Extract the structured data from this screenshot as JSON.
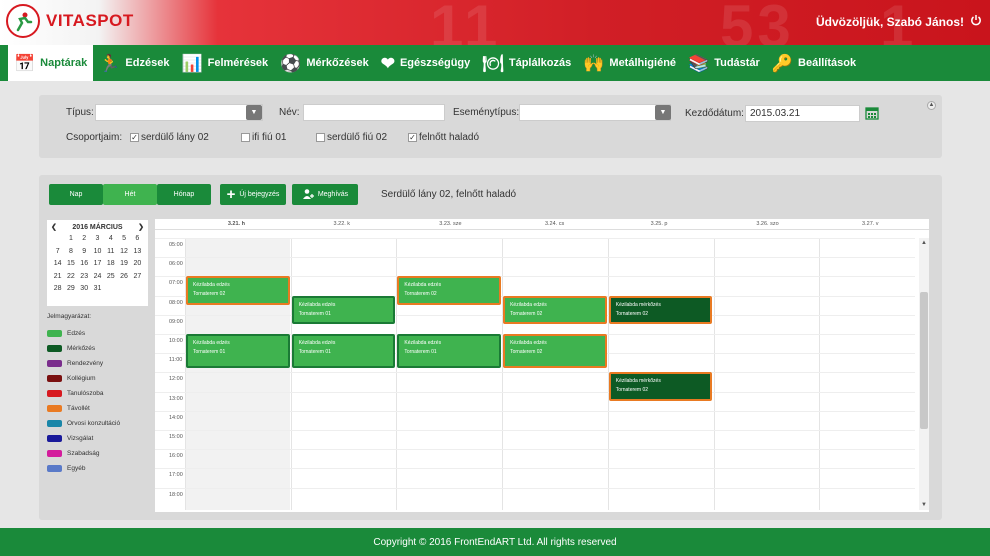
{
  "header": {
    "brand": "VITASPOT",
    "welcome": "Üdvözöljük, Szabó János!",
    "ghost_numbers": [
      "11",
      "53",
      "1"
    ]
  },
  "nav": [
    {
      "label": "Naptárak",
      "icon": "calendar-icon",
      "glyph": "📅",
      "active": true
    },
    {
      "label": "Edzések",
      "icon": "running-icon",
      "glyph": "🏃"
    },
    {
      "label": "Felmérések",
      "icon": "bar-chart-icon",
      "glyph": "📊"
    },
    {
      "label": "Mérkőzések",
      "icon": "players-icon",
      "glyph": "⚽"
    },
    {
      "label": "Egészségügy",
      "icon": "heart-icon",
      "glyph": "❤"
    },
    {
      "label": "Táplálkozás",
      "icon": "plate-icon",
      "glyph": "🍽"
    },
    {
      "label": "Metálhigiéné",
      "icon": "hands-icon",
      "glyph": "🙌"
    },
    {
      "label": "Tudástár",
      "icon": "books-icon",
      "glyph": "📚"
    },
    {
      "label": "Beállítások",
      "icon": "key-icon",
      "glyph": "🔑"
    }
  ],
  "filter": {
    "type_label": "Típus:",
    "name_label": "Név:",
    "event_type_label": "Eseménytípus:",
    "start_label": "Kezdődátum:",
    "start_value": "2015.03.21",
    "groups_label": "Csoportjaim:",
    "groups": [
      {
        "label": "serdülő lány 02",
        "checked": true
      },
      {
        "label": "ifi fiú 01",
        "checked": false
      },
      {
        "label": "serdülő fiú 02",
        "checked": false
      },
      {
        "label": "felnőtt haladó",
        "checked": true
      }
    ]
  },
  "toolbar": {
    "day": "Nap",
    "week": "Hét",
    "month": "Hónap",
    "new_entry": "Új bejegyzés",
    "invite": "Meghívás",
    "selected_groups": "Serdülő lány 02, felnőtt haladó"
  },
  "mini_calendar": {
    "title": "2016 MÁRCIUS",
    "prev": "❮",
    "next": "❯",
    "days": [
      "1",
      "2",
      "3",
      "4",
      "5",
      "6",
      "7",
      "8",
      "9",
      "10",
      "11",
      "12",
      "13",
      "14",
      "15",
      "16",
      "17",
      "18",
      "19",
      "20",
      "21",
      "22",
      "23",
      "24",
      "25",
      "26",
      "27",
      "28",
      "29",
      "30",
      "31"
    ]
  },
  "legend": {
    "title": "Jelmagyarázat:",
    "items": [
      {
        "label": "Edzés",
        "color": "#3fb34f"
      },
      {
        "label": "Mérkőzés",
        "color": "#0d5a24"
      },
      {
        "label": "Rendezvény",
        "color": "#7a2d8c"
      },
      {
        "label": "Kollégium",
        "color": "#7a1010"
      },
      {
        "label": "Tanulószoba",
        "color": "#d71920"
      },
      {
        "label": "Távollét",
        "color": "#e97a22"
      },
      {
        "label": "Orvosi konzultáció",
        "color": "#1a86a8"
      },
      {
        "label": "Vizsgálat",
        "color": "#1a1a9a"
      },
      {
        "label": "Szabadság",
        "color": "#d41c9c"
      },
      {
        "label": "Egyéb",
        "color": "#5a7ac8"
      }
    ]
  },
  "week": {
    "days": [
      "3.21. h",
      "3.22. k",
      "3.23. sze",
      "3.24. cs",
      "3.25. p",
      "3.26. szo",
      "3.27. v"
    ],
    "hours": [
      "05:00",
      "06:00",
      "07:00",
      "08:00",
      "09:00",
      "10:00",
      "11:00",
      "12:00",
      "13:00",
      "14:00",
      "15:00",
      "16:00",
      "17:00",
      "18:00"
    ],
    "events": [
      {
        "day": 0,
        "start": 7.0,
        "end": 8.5,
        "title": "Kézilabda edzés",
        "place": "Tornaterem 02",
        "kind": "edzes-orange"
      },
      {
        "day": 1,
        "start": 8.0,
        "end": 9.5,
        "title": "Kézilabda edzés",
        "place": "Tornaterem 01",
        "kind": "edzes-green"
      },
      {
        "day": 2,
        "start": 7.0,
        "end": 8.5,
        "title": "Kézilabda edzés",
        "place": "Tornaterem 02",
        "kind": "edzes-orange"
      },
      {
        "day": 3,
        "start": 8.0,
        "end": 9.5,
        "title": "Kézilabda edzés",
        "place": "Tornaterem 02",
        "kind": "edzes-orange"
      },
      {
        "day": 4,
        "start": 8.0,
        "end": 9.5,
        "title": "Kézilabda mérkőzés",
        "place": "Tornaterem 02",
        "kind": "match"
      },
      {
        "day": 0,
        "start": 10.0,
        "end": 11.75,
        "title": "Kézilabda edzés",
        "place": "Tornaterem 01",
        "kind": "edzes-green"
      },
      {
        "day": 1,
        "start": 10.0,
        "end": 11.75,
        "title": "Kézilabda edzés",
        "place": "Tornaterem 01",
        "kind": "edzes-green"
      },
      {
        "day": 2,
        "start": 10.0,
        "end": 11.75,
        "title": "Kézilabda edzés",
        "place": "Tornaterem 01",
        "kind": "edzes-green"
      },
      {
        "day": 3,
        "start": 10.0,
        "end": 11.75,
        "title": "Kézilabda edzés",
        "place": "Tornaterem 02",
        "kind": "edzes-orange"
      },
      {
        "day": 4,
        "start": 12.0,
        "end": 13.5,
        "title": "Kézilabda mérkőzés",
        "place": "Tornaterem 02",
        "kind": "match"
      }
    ]
  },
  "footer": {
    "copyright": "Copyright © 2016 FrontEndART Ltd. All rights reserved"
  }
}
